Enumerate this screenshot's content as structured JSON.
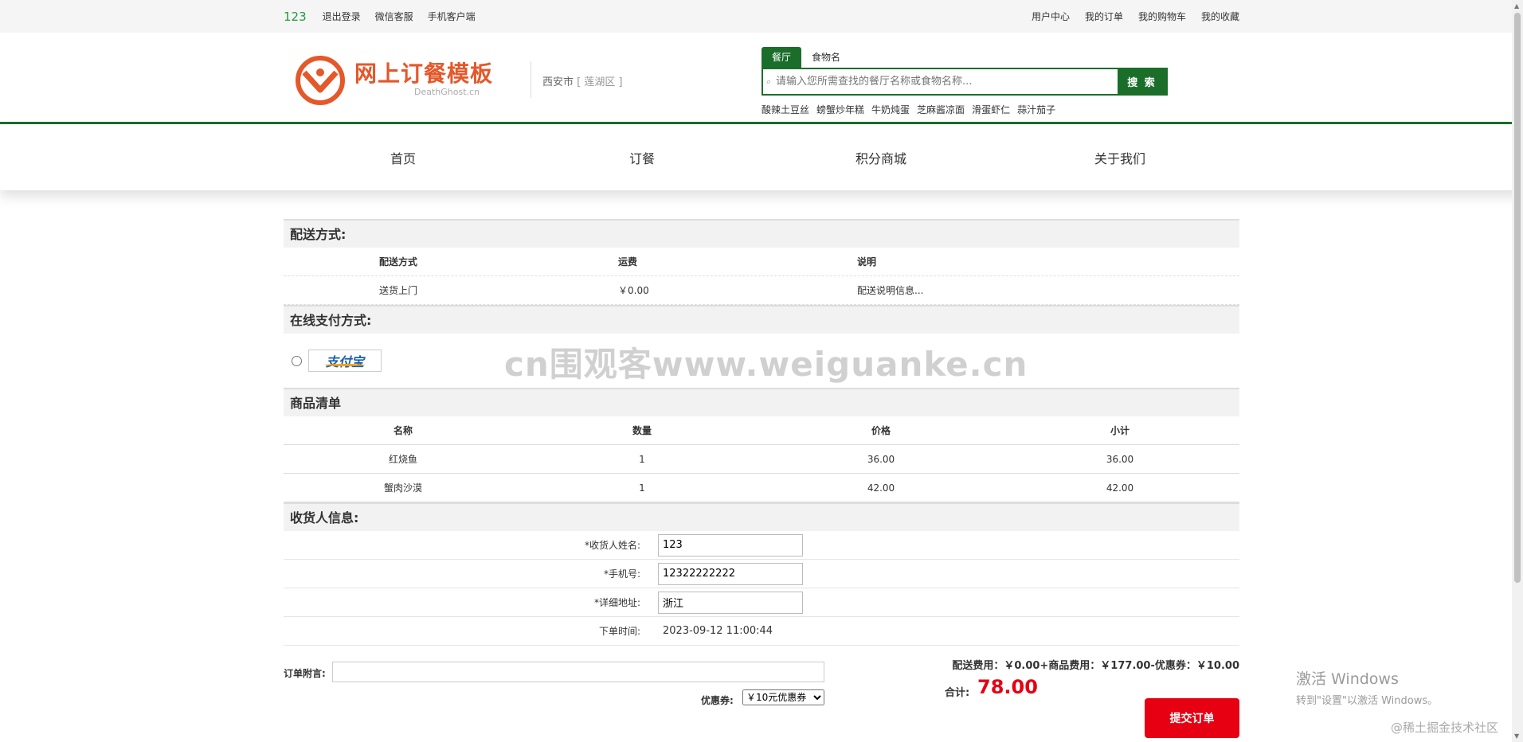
{
  "topbar": {
    "user": "123",
    "left_links": [
      "退出登录",
      "微信客服",
      "手机客户端"
    ],
    "right_links": [
      "用户中心",
      "我的订单",
      "我的购物车",
      "我的收藏"
    ]
  },
  "header": {
    "logo_text": "网上订餐模板",
    "logo_sub": "DeathGhost.cn",
    "city": "西安市",
    "district": "[ 莲湖区 ]",
    "search": {
      "tabs": [
        "餐厅",
        "食物名"
      ],
      "placeholder": "请输入您所需查找的餐厅名称或食物名称...",
      "button": "搜 索",
      "hot": [
        "酸辣土豆丝",
        "螃蟹炒年糕",
        "牛奶炖蛋",
        "芝麻酱凉面",
        "滑蛋虾仁",
        "蒜汁茄子"
      ]
    }
  },
  "nav": [
    "首页",
    "订餐",
    "积分商城",
    "关于我们"
  ],
  "delivery": {
    "title": "配送方式:",
    "headers": [
      "配送方式",
      "运费",
      "说明"
    ],
    "row": [
      "送货上门",
      "￥0.00",
      "配送说明信息..."
    ]
  },
  "payment": {
    "title": "在线支付方式:",
    "alipay": "支付宝"
  },
  "goods": {
    "title": "商品清单",
    "headers": [
      "名称",
      "数量",
      "价格",
      "小计"
    ],
    "rows": [
      [
        "红烧鱼",
        "1",
        "36.00",
        "36.00"
      ],
      [
        "蟹肉沙漠",
        "1",
        "42.00",
        "42.00"
      ]
    ]
  },
  "receiver": {
    "title": "收货人信息:",
    "name_label": "*收货人姓名:",
    "name_value": "123",
    "phone_label": "*手机号:",
    "phone_value": "12322222222",
    "address_label": "*详细地址:",
    "address_value": "浙江",
    "time_label": "下单时间:",
    "time_value": "2023-09-12 11:00:44"
  },
  "summary": {
    "note_label": "订单附言:",
    "coupon_label": "优惠券:",
    "coupon_value": "￥10元优惠券",
    "fees": "配送费用：￥0.00+商品费用：￥177.00-优惠券：￥10.00",
    "total_label": "合计:",
    "total_value": "78.00",
    "submit": "提交订单"
  },
  "overlay": {
    "watermark": "cn围观客www.weiguanke.cn",
    "activate_title": "激活 Windows",
    "activate_sub": "转到\"设置\"以激活 Windows。",
    "credit": "@稀土掘金技术社区"
  },
  "colors": {
    "brand_green": "#1a6e2a",
    "accent_orange": "#e4582a",
    "price_red": "#e60012"
  }
}
